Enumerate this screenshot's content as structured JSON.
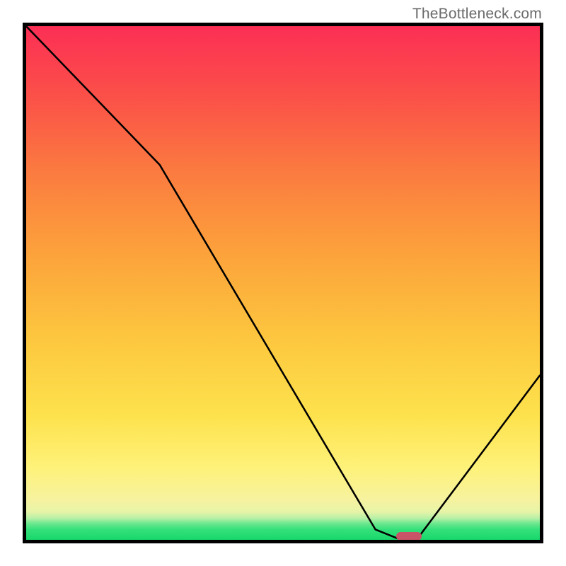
{
  "watermark": "TheBottleneck.com",
  "chart_data": {
    "type": "line",
    "title": "",
    "xlabel": "",
    "ylabel": "",
    "xlim": [
      0,
      100
    ],
    "ylim": [
      0,
      100
    ],
    "x": [
      0,
      26,
      68,
      73,
      76,
      100
    ],
    "values": [
      100,
      73,
      2,
      0,
      0,
      32
    ],
    "marker": {
      "x_start": 72,
      "x_end": 77,
      "y": 0
    },
    "background_gradient": {
      "stops": [
        {
          "pos": 0,
          "color": "#17d86b"
        },
        {
          "pos": 6,
          "color": "#e8f4a8"
        },
        {
          "pos": 14,
          "color": "#fef27a"
        },
        {
          "pos": 38,
          "color": "#fdc93f"
        },
        {
          "pos": 72,
          "color": "#fb7a40"
        },
        {
          "pos": 100,
          "color": "#fc2f55"
        }
      ]
    }
  }
}
